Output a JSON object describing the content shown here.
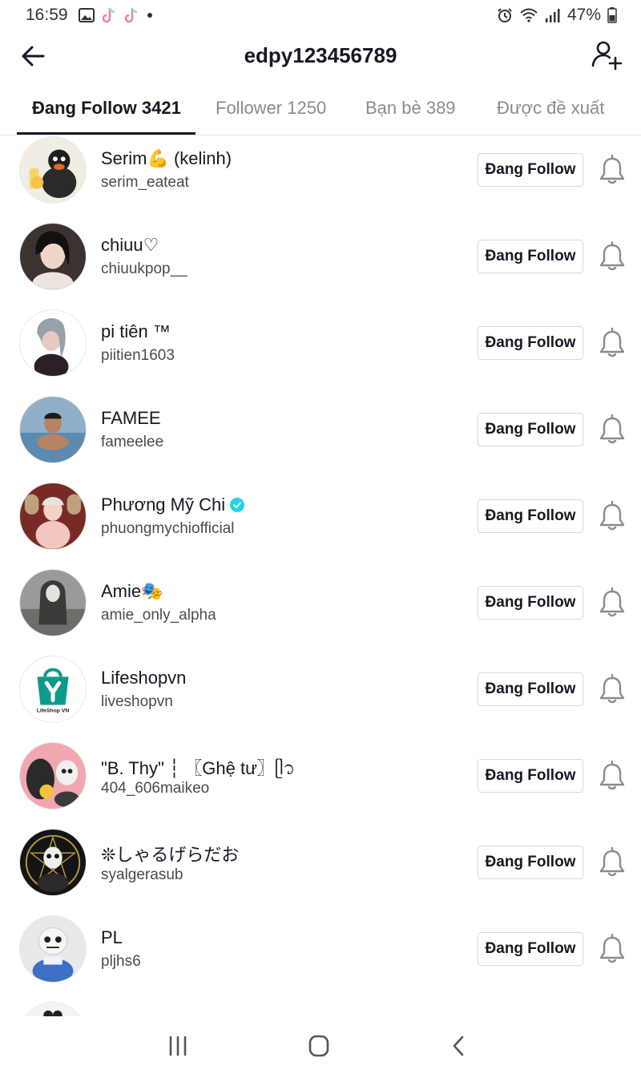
{
  "status": {
    "time": "16:59",
    "battery": "47%",
    "icons_left": [
      "gallery-icon",
      "tiktok-icon",
      "tiktok-icon",
      "dot-icon"
    ],
    "icons_right": [
      "alarm-icon",
      "wifi-icon",
      "signal-icon",
      "battery-icon"
    ]
  },
  "header": {
    "title": "edpy123456789"
  },
  "tabs": [
    {
      "label": "Đang Follow 3421",
      "active": true
    },
    {
      "label": "Follower 1250",
      "active": false
    },
    {
      "label": "Bạn bè 389",
      "active": false
    },
    {
      "label": "Được đề xuất",
      "active": false
    }
  ],
  "follow_label": "Đang Follow",
  "users": [
    {
      "name": "Serim💪 (kelinh)",
      "handle": "serim_eateat",
      "verified": false
    },
    {
      "name": "chiuu♡",
      "handle": "chiuukpop__",
      "verified": false
    },
    {
      "name": "pi tiên ™",
      "handle": "piitien1603",
      "verified": false
    },
    {
      "name": "FAMEE",
      "handle": "fameelee",
      "verified": false
    },
    {
      "name": "Phương Mỹ Chi",
      "handle": "phuongmychiofficial",
      "verified": true
    },
    {
      "name": "Amie🎭",
      "handle": "amie_only_alpha",
      "verified": false
    },
    {
      "name": "Lifeshopvn",
      "handle": "liveshopvn",
      "verified": false
    },
    {
      "name": "\"B. Thy\" ┆ 〖Ghệ tư〗ᥫ᭡",
      "handle": "404_606maikeo",
      "verified": false
    },
    {
      "name": "❊しゃるげらだお",
      "handle": "syalgerasub",
      "verified": false
    },
    {
      "name": "PL",
      "handle": "pljhs6",
      "verified": false
    }
  ],
  "colors": {
    "text": "#161823",
    "muted": "#8a8b91",
    "verified": "#20d5ec",
    "border": "#d8d8da"
  }
}
